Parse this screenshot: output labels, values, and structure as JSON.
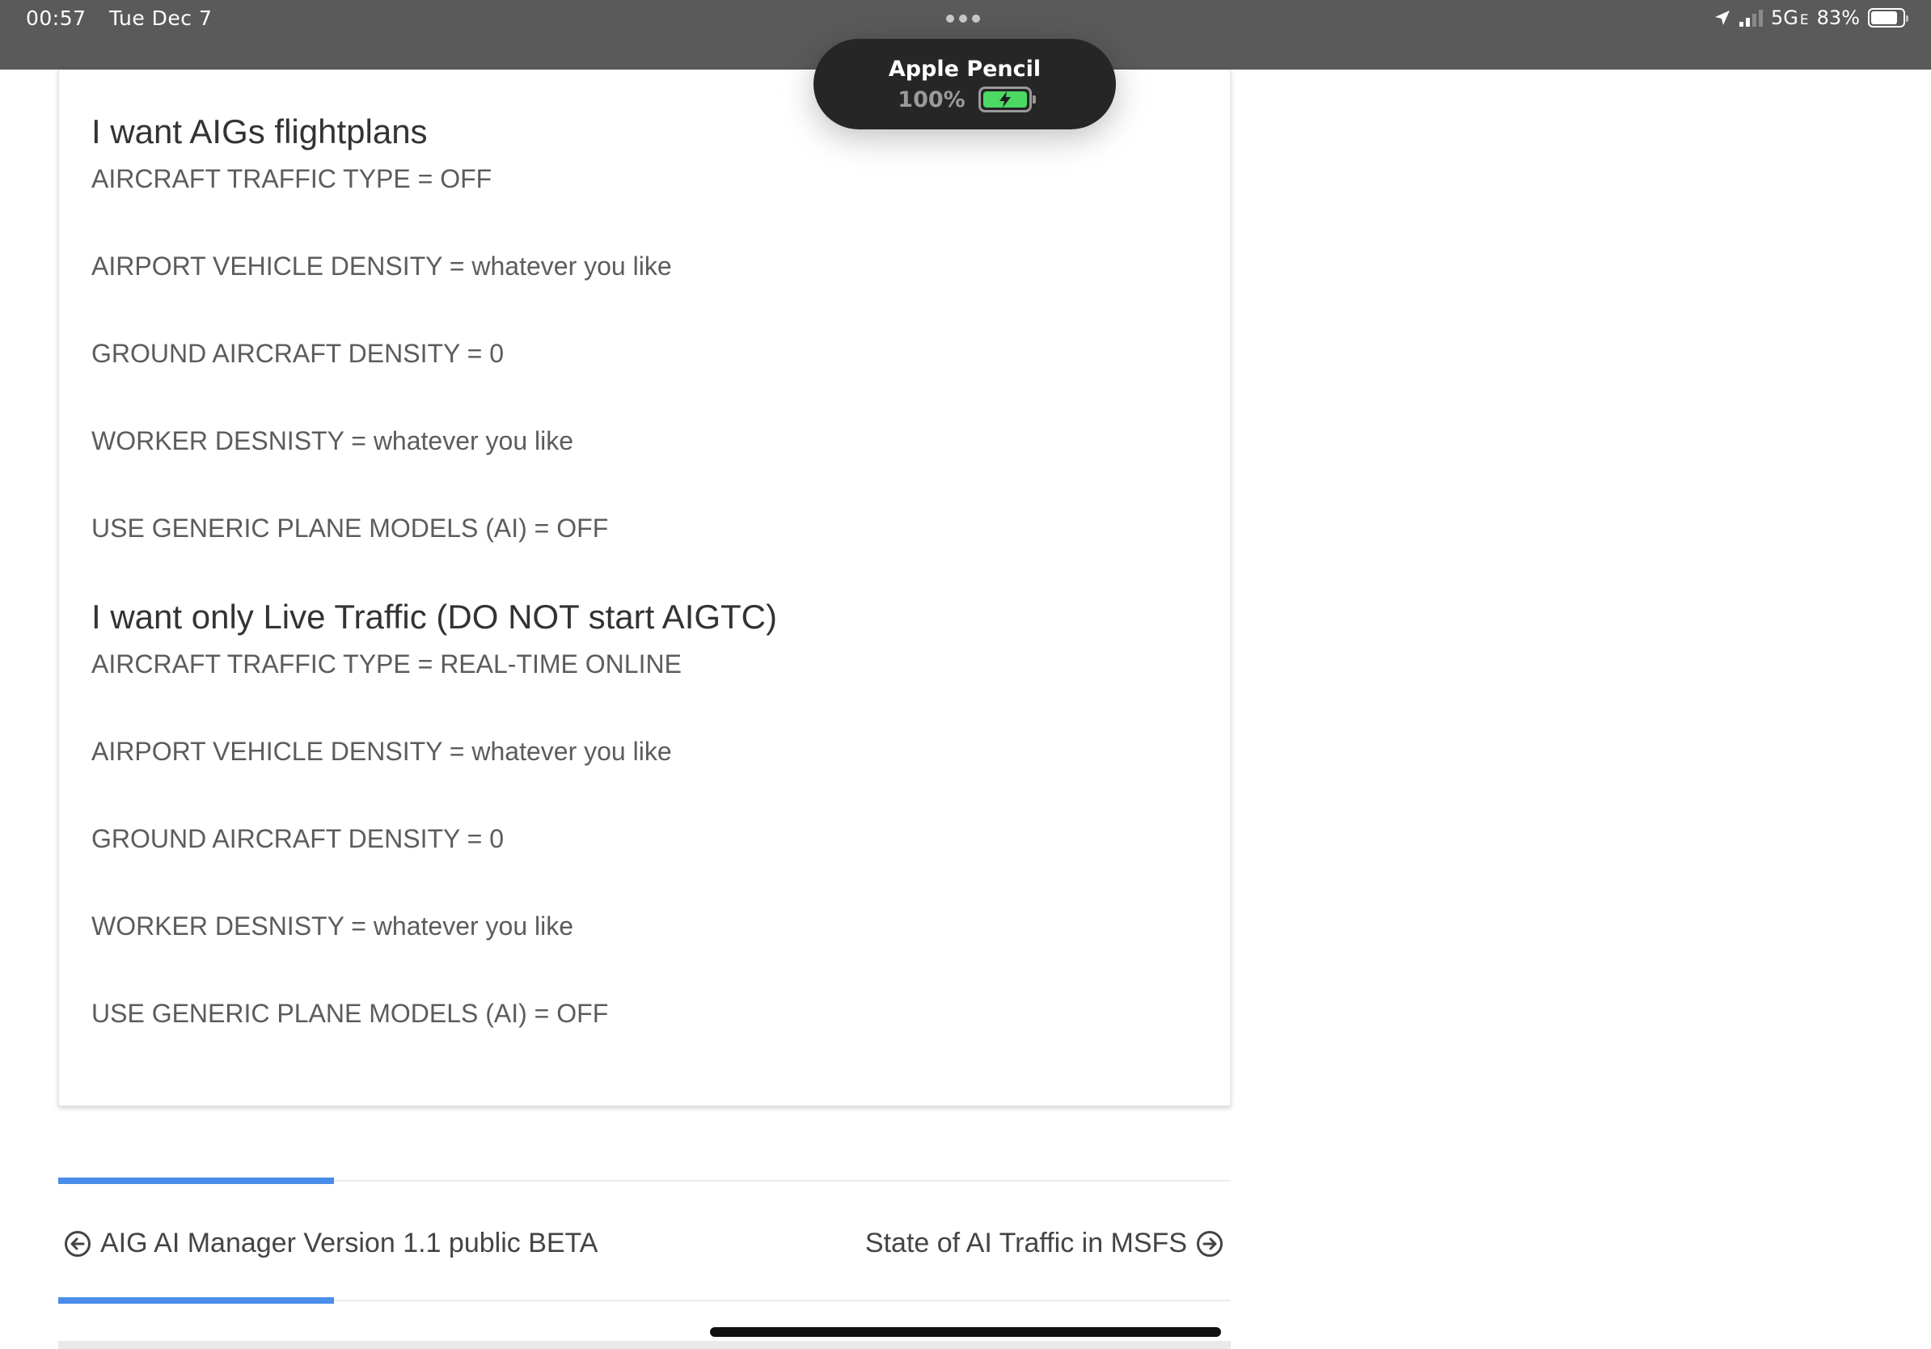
{
  "status_bar": {
    "time": "00:57",
    "date": "Tue Dec 7",
    "network": "5G",
    "network_suffix": "E",
    "battery_percent": "83%",
    "battery_level": 0.83
  },
  "pencil_popup": {
    "name": "Apple Pencil",
    "battery": "100%",
    "battery_color": "#4cd964"
  },
  "sections": [
    {
      "heading": "I want AIGs flightplans",
      "lines": [
        "AIRCRAFT TRAFFIC TYPE = OFF",
        "AIRPORT VEHICLE DENSITY = whatever you like",
        "GROUND AIRCRAFT DENSITY = 0",
        "WORKER DESNISTY = whatever you like",
        "USE GENERIC PLANE MODELS (AI) = OFF"
      ]
    },
    {
      "heading": "I want only Live Traffic (DO NOT start AIGTC)",
      "lines": [
        "AIRCRAFT TRAFFIC TYPE = REAL-TIME ONLINE",
        "AIRPORT VEHICLE DENSITY = whatever you like",
        "GROUND AIRCRAFT DENSITY = 0",
        "WORKER DESNISTY = whatever you like",
        "USE GENERIC PLANE MODELS (AI) = OFF"
      ]
    }
  ],
  "post_nav": {
    "previous": "AIG AI Manager Version 1.1 public BETA",
    "next": "State of AI Traffic in MSFS",
    "accent_color": "#4a8de8"
  }
}
